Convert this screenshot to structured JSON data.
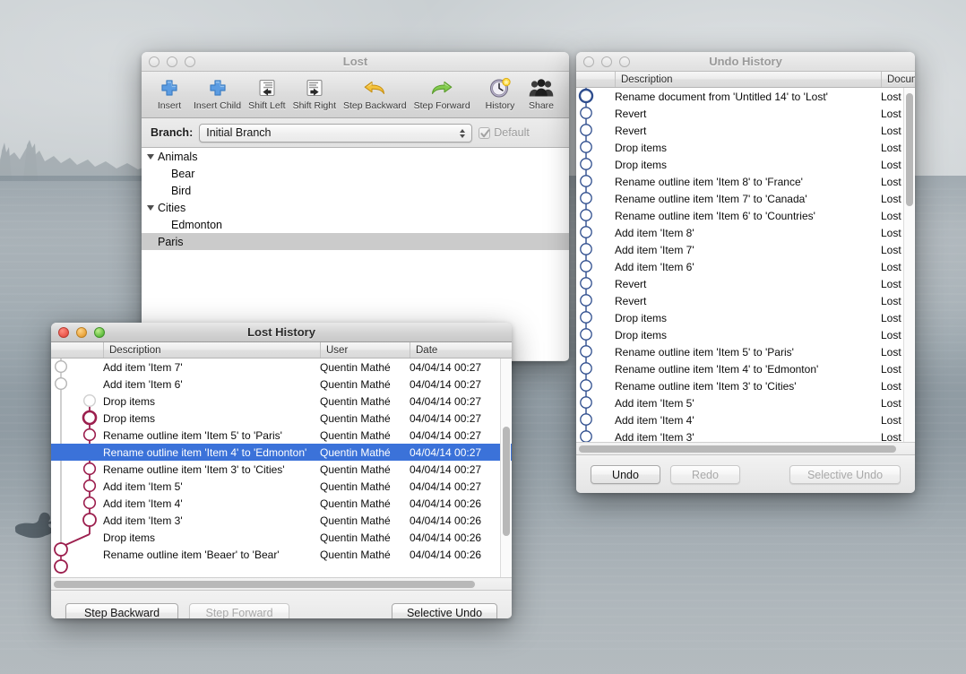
{
  "desktop": {
    "wallpaper_description": "misty lake with treeline and duck silhouette"
  },
  "lost_window": {
    "title": "Lost",
    "toolbar": [
      {
        "label": "Insert",
        "icon": "plus-icon"
      },
      {
        "label": "Insert Child",
        "icon": "plus-child-icon"
      },
      {
        "label": "Shift Left",
        "icon": "arrow-left-icon"
      },
      {
        "label": "Shift Right",
        "icon": "arrow-right-icon"
      },
      {
        "label": "Step Backward",
        "icon": "undo-arrow-icon"
      },
      {
        "label": "Step Forward",
        "icon": "redo-arrow-icon"
      },
      {
        "label": "History",
        "icon": "clock-history-icon"
      },
      {
        "label": "Share",
        "icon": "people-share-icon"
      }
    ],
    "branch": {
      "label": "Branch:",
      "value": "Initial Branch",
      "default_checkbox_label": "Default",
      "default_checked": true,
      "default_enabled": false
    },
    "outline": [
      {
        "text": "Animals",
        "indent": 0,
        "expandable": true,
        "selected": false
      },
      {
        "text": "Bear",
        "indent": 1,
        "expandable": false,
        "selected": false
      },
      {
        "text": "Bird",
        "indent": 1,
        "expandable": false,
        "selected": false
      },
      {
        "text": "Cities",
        "indent": 0,
        "expandable": true,
        "selected": false
      },
      {
        "text": "Edmonton",
        "indent": 1,
        "expandable": false,
        "selected": false
      },
      {
        "text": "Paris",
        "indent": 0,
        "expandable": false,
        "selected": true
      }
    ]
  },
  "undo_history_window": {
    "title": "Undo History",
    "columns": [
      "Description",
      "Document"
    ],
    "rows": [
      {
        "description": "Rename document from 'Untitled 14' to 'Lost'",
        "document": "Lost"
      },
      {
        "description": "Revert",
        "document": "Lost"
      },
      {
        "description": "Revert",
        "document": "Lost"
      },
      {
        "description": "Drop items",
        "document": "Lost"
      },
      {
        "description": "Drop items",
        "document": "Lost"
      },
      {
        "description": "Rename outline item 'Item 8' to 'France'",
        "document": "Lost"
      },
      {
        "description": "Rename outline item 'Item 7' to 'Canada'",
        "document": "Lost"
      },
      {
        "description": "Rename outline item 'Item 6' to 'Countries'",
        "document": "Lost"
      },
      {
        "description": "Add item 'Item 8'",
        "document": "Lost"
      },
      {
        "description": "Add item 'Item 7'",
        "document": "Lost"
      },
      {
        "description": "Add item 'Item 6'",
        "document": "Lost"
      },
      {
        "description": "Revert",
        "document": "Lost"
      },
      {
        "description": "Revert",
        "document": "Lost"
      },
      {
        "description": "Drop items",
        "document": "Lost"
      },
      {
        "description": "Drop items",
        "document": "Lost"
      },
      {
        "description": "Rename outline item 'Item 5' to 'Paris'",
        "document": "Lost"
      },
      {
        "description": "Rename outline item 'Item 4' to 'Edmonton'",
        "document": "Lost"
      },
      {
        "description": "Rename outline item 'Item 3' to 'Cities'",
        "document": "Lost"
      },
      {
        "description": "Add item 'Item 5'",
        "document": "Lost"
      },
      {
        "description": "Add item 'Item 4'",
        "document": "Lost"
      },
      {
        "description": "Add item 'Item 3'",
        "document": "Lost"
      }
    ],
    "buttons": [
      {
        "label": "Undo",
        "enabled": true
      },
      {
        "label": "Redo",
        "enabled": false
      },
      {
        "label": "Selective Undo",
        "enabled": false
      }
    ],
    "graph_color": "#2f4e8e",
    "current_node_index": 0
  },
  "lost_history_window": {
    "title": "Lost History",
    "columns": [
      "Description",
      "User",
      "Date"
    ],
    "rows": [
      {
        "description": "Add item 'Item 7'",
        "user": "Quentin Mathé",
        "date": "04/04/14 00:27",
        "lane": 0,
        "node": "open-gray",
        "selected": false
      },
      {
        "description": "Add item 'Item 6'",
        "user": "Quentin Mathé",
        "date": "04/04/14 00:27",
        "lane": 0,
        "node": "open-gray",
        "selected": false
      },
      {
        "description": "Drop items",
        "user": "Quentin Mathé",
        "date": "04/04/14 00:27",
        "lane": 1,
        "node": "open-gray",
        "selected": false
      },
      {
        "description": "Drop items",
        "user": "Quentin Mathé",
        "date": "04/04/14 00:27",
        "lane": 1,
        "node": "thick-maroon",
        "selected": false
      },
      {
        "description": "Rename outline item 'Item 5' to 'Paris'",
        "user": "Quentin Mathé",
        "date": "04/04/14 00:27",
        "lane": 1,
        "node": "open-maroon",
        "selected": false
      },
      {
        "description": "Rename outline item 'Item 4' to 'Edmonton'",
        "user": "Quentin Mathé",
        "date": "04/04/14 00:27",
        "lane": 1,
        "node": "filled-white",
        "selected": true
      },
      {
        "description": "Rename outline item 'Item 3' to 'Cities'",
        "user": "Quentin Mathé",
        "date": "04/04/14 00:27",
        "lane": 1,
        "node": "open-maroon",
        "selected": false
      },
      {
        "description": "Add item 'Item 5'",
        "user": "Quentin Mathé",
        "date": "04/04/14 00:27",
        "lane": 1,
        "node": "open-maroon",
        "selected": false
      },
      {
        "description": "Add item 'Item 4'",
        "user": "Quentin Mathé",
        "date": "04/04/14 00:26",
        "lane": 1,
        "node": "open-maroon",
        "selected": false
      },
      {
        "description": "Add item 'Item 3'",
        "user": "Quentin Mathé",
        "date": "04/04/14 00:26",
        "lane": 1,
        "node": "open-maroon",
        "selected": false
      },
      {
        "description": "Drop items",
        "user": "Quentin Mathé",
        "date": "04/04/14 00:26",
        "lane": 0,
        "node": "open-maroon",
        "selected": false
      },
      {
        "description": "Rename outline item 'Beaer' to 'Bear'",
        "user": "Quentin Mathé",
        "date": "04/04/14 00:26",
        "lane": 0,
        "node": "open-maroon",
        "selected": false
      }
    ],
    "buttons": [
      {
        "label": "Step Backward",
        "enabled": true
      },
      {
        "label": "Step Forward",
        "enabled": false
      },
      {
        "label": "Selective Undo",
        "enabled": true
      }
    ],
    "graph_color_primary": "#9c1f4e",
    "graph_color_secondary": "#b5b5b5",
    "selection_color": "#3b72d9"
  }
}
